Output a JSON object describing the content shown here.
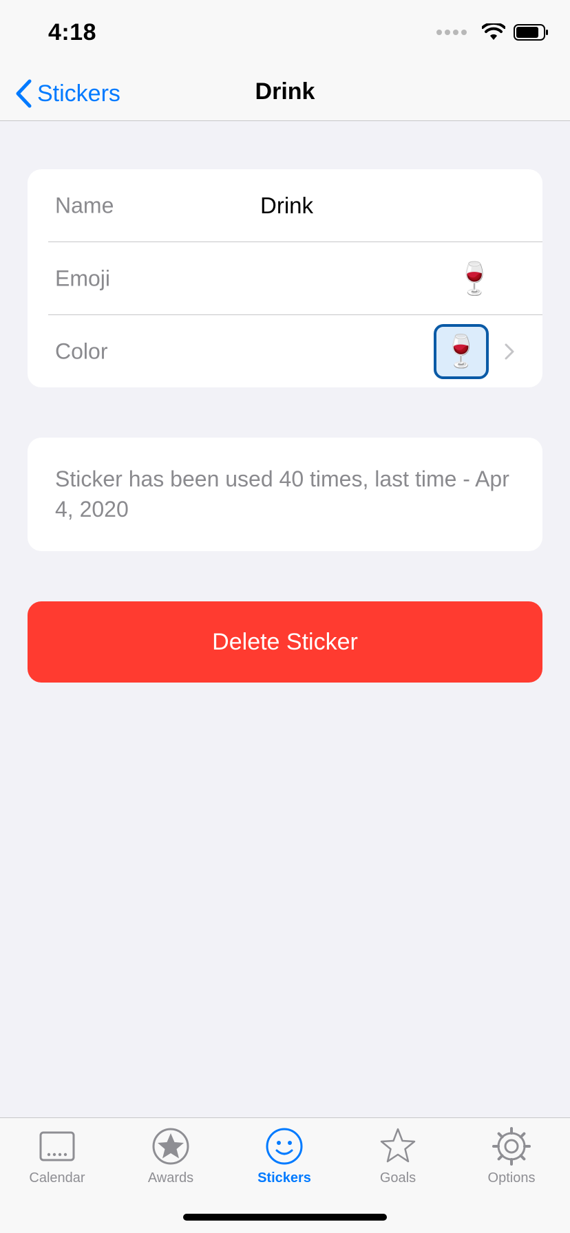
{
  "status_bar": {
    "time": "4:18"
  },
  "nav": {
    "back_label": "Stickers",
    "title": "Drink"
  },
  "form": {
    "name_label": "Name",
    "name_value": "Drink",
    "emoji_label": "Emoji",
    "emoji_value": "🍷",
    "color_label": "Color",
    "color_swatch_emoji": "🍷"
  },
  "info": {
    "text": "Sticker has been used 40 times, last time - Apr 4, 2020"
  },
  "delete_label": "Delete Sticker",
  "tabs": [
    {
      "label": "Calendar",
      "icon": "calendar-icon"
    },
    {
      "label": "Awards",
      "icon": "award-star-icon"
    },
    {
      "label": "Stickers",
      "icon": "smiley-icon"
    },
    {
      "label": "Goals",
      "icon": "star-outline-icon"
    },
    {
      "label": "Options",
      "icon": "gear-icon"
    }
  ],
  "active_tab": "Stickers",
  "colors": {
    "accent": "#007aff",
    "destructive": "#ff3b30",
    "background": "#f2f2f7",
    "swatch_border": "#0a5aa6",
    "swatch_fill": "#dcecfb"
  }
}
